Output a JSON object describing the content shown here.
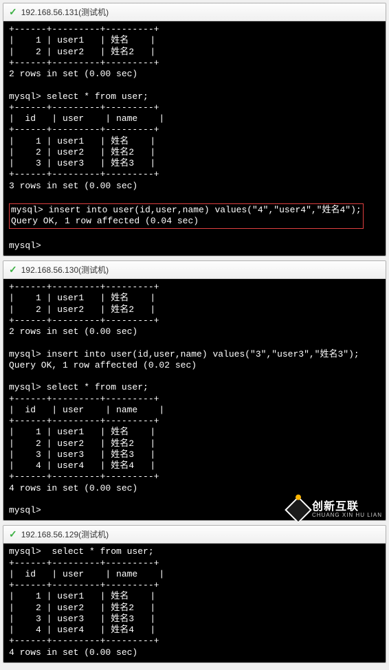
{
  "panels": [
    {
      "title": "192.168.56.131(测试机)",
      "blocks": [
        {
          "type": "divider"
        },
        {
          "type": "row",
          "id": "1",
          "user": "user1",
          "name": "姓名"
        },
        {
          "type": "row",
          "id": "2",
          "user": "user2",
          "name": "姓名2"
        },
        {
          "type": "divider"
        },
        {
          "type": "text",
          "text": "2 rows in set (0.00 sec)"
        },
        {
          "type": "blank"
        },
        {
          "type": "text",
          "text": "mysql> select * from user;"
        },
        {
          "type": "divider"
        },
        {
          "type": "header",
          "id": "id",
          "user": "user",
          "name": "name"
        },
        {
          "type": "divider"
        },
        {
          "type": "row",
          "id": "1",
          "user": "user1",
          "name": "姓名"
        },
        {
          "type": "row",
          "id": "2",
          "user": "user2",
          "name": "姓名2"
        },
        {
          "type": "row",
          "id": "3",
          "user": "user3",
          "name": "姓名3"
        },
        {
          "type": "divider"
        },
        {
          "type": "text",
          "text": "3 rows in set (0.00 sec)"
        },
        {
          "type": "blank"
        },
        {
          "type": "hl-start"
        },
        {
          "type": "text",
          "text": "mysql> insert into user(id,user,name) values(\"4\",\"user4\",\"姓名4\");"
        },
        {
          "type": "text",
          "text": "Query OK, 1 row affected (0.04 sec)"
        },
        {
          "type": "hl-end"
        },
        {
          "type": "blank"
        },
        {
          "type": "text",
          "text": "mysql>"
        }
      ]
    },
    {
      "title": "192.168.56.130(测试机)",
      "blocks": [
        {
          "type": "divider"
        },
        {
          "type": "row",
          "id": "1",
          "user": "user1",
          "name": "姓名"
        },
        {
          "type": "row",
          "id": "2",
          "user": "user2",
          "name": "姓名2"
        },
        {
          "type": "divider"
        },
        {
          "type": "text",
          "text": "2 rows in set (0.00 sec)"
        },
        {
          "type": "blank"
        },
        {
          "type": "text",
          "text": "mysql> insert into user(id,user,name) values(\"3\",\"user3\",\"姓名3\");"
        },
        {
          "type": "text",
          "text": "Query OK, 1 row affected (0.02 sec)"
        },
        {
          "type": "blank"
        },
        {
          "type": "text",
          "text": "mysql> select * from user;"
        },
        {
          "type": "divider"
        },
        {
          "type": "header",
          "id": "id",
          "user": "user",
          "name": "name"
        },
        {
          "type": "divider"
        },
        {
          "type": "row",
          "id": "1",
          "user": "user1",
          "name": "姓名"
        },
        {
          "type": "row",
          "id": "2",
          "user": "user2",
          "name": "姓名2"
        },
        {
          "type": "row",
          "id": "3",
          "user": "user3",
          "name": "姓名3"
        },
        {
          "type": "row",
          "id": "4",
          "user": "user4",
          "name": "姓名4"
        },
        {
          "type": "divider"
        },
        {
          "type": "text",
          "text": "4 rows in set (0.00 sec)"
        },
        {
          "type": "blank"
        },
        {
          "type": "text",
          "text": "mysql>"
        }
      ]
    },
    {
      "title": "192.168.56.129(测试机)",
      "blocks": [
        {
          "type": "text",
          "text": "mysql>  select * from user;"
        },
        {
          "type": "divider"
        },
        {
          "type": "header",
          "id": "id",
          "user": "user",
          "name": "name"
        },
        {
          "type": "divider"
        },
        {
          "type": "row",
          "id": "1",
          "user": "user1",
          "name": "姓名"
        },
        {
          "type": "row",
          "id": "2",
          "user": "user2",
          "name": "姓名2"
        },
        {
          "type": "row",
          "id": "3",
          "user": "user3",
          "name": "姓名3"
        },
        {
          "type": "row",
          "id": "4",
          "user": "user4",
          "name": "姓名4"
        },
        {
          "type": "divider"
        },
        {
          "type": "text",
          "text": "4 rows in set (0.00 sec)"
        }
      ]
    }
  ],
  "watermark": {
    "cn": "创新互联",
    "en": "CHUANG XIN HU LIAN"
  }
}
